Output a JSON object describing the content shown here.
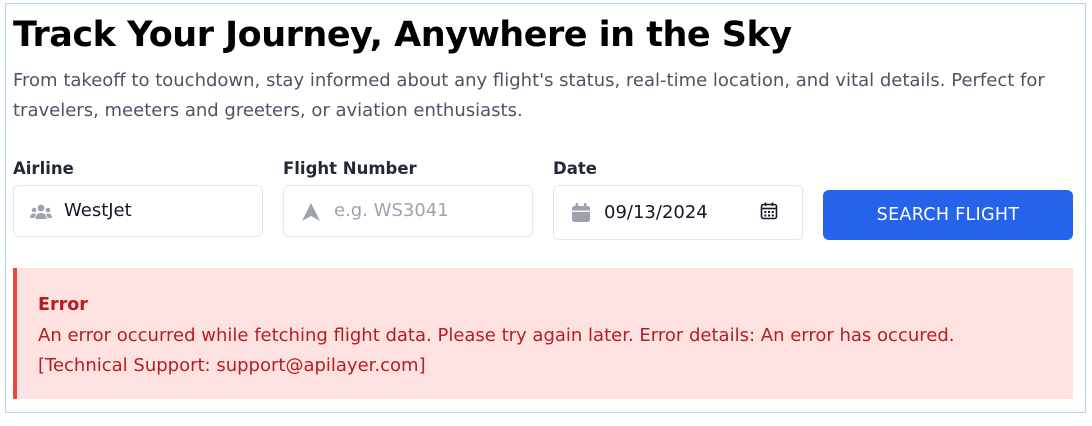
{
  "header": {
    "title": "Track Your Journey, Anywhere in the Sky",
    "subtitle": "From takeoff to touchdown, stay informed about any flight's status, real-time location, and vital details. Perfect for travelers, meeters and greeters, or aviation enthusiasts."
  },
  "form": {
    "airline": {
      "label": "Airline",
      "value": "WestJet",
      "icon": "users-icon"
    },
    "flight_number": {
      "label": "Flight Number",
      "value": "",
      "placeholder": "e.g. WS3041",
      "icon": "plane-icon"
    },
    "date": {
      "label": "Date",
      "value": "09/13/2024",
      "icon": "calendar-icon",
      "picker_icon": "calendar-picker-icon"
    },
    "search_label": "SEARCH FLIGHT"
  },
  "error": {
    "title": "Error",
    "message": "An error occurred while fetching flight data. Please try again later. Error details: An error has occured. [Technical Support: support@apilayer.com]"
  },
  "colors": {
    "accent": "#2563eb",
    "error_bg": "#fee2e2",
    "error_border": "#ef4444",
    "error_text": "#b91c1c",
    "frame_border": "#a9dcef"
  }
}
